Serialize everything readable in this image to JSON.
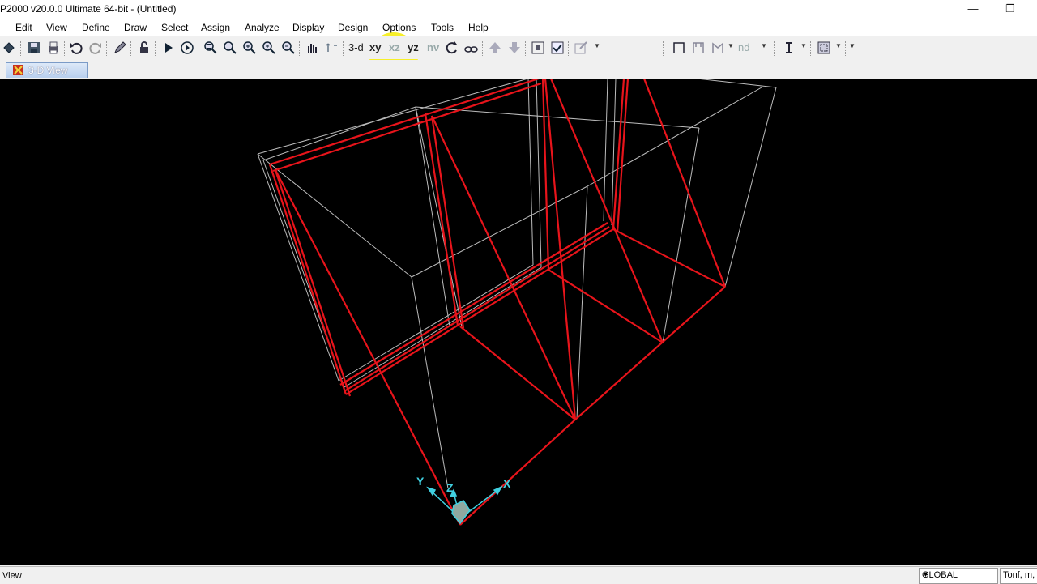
{
  "window": {
    "title": "P2000 v20.0.0 Ultimate 64-bit - (Untitled)",
    "minimize": "—",
    "restore": "❐"
  },
  "menu": [
    "Edit",
    "View",
    "Define",
    "Draw",
    "Select",
    "Assign",
    "Analyze",
    "Display",
    "Design",
    "Options",
    "Tools",
    "Help"
  ],
  "toolbar": {
    "view_3d": "3-d",
    "view_xy": "xy",
    "view_xz": "xz",
    "view_yz": "yz",
    "view_nv": "nv",
    "nd": "nd",
    "icons": [
      "pointer-icon",
      "save-icon",
      "print-icon",
      "undo-icon",
      "redo-icon",
      "pencil-icon",
      "lock-icon",
      "run-icon",
      "run-options-icon",
      "zoom-window-icon",
      "zoom-restore-icon",
      "zoom-in-icon",
      "zoom-in-step-icon",
      "zoom-out-icon",
      "pan-icon",
      "pan-move-icon",
      "rotate-icon",
      "perspective-icon",
      "up-arrow-icon",
      "down-arrow-icon",
      "shrink-icon",
      "check-icon",
      "edit-icon",
      "frame-icon",
      "frame-release-icon",
      "frame-hinge-icon",
      "text-icon",
      "area-icon"
    ]
  },
  "tab": {
    "label": "3-D View"
  },
  "viewport": {
    "background": "#000000",
    "frame_color": "#e8141b",
    "grid_color": "#bcbcbc",
    "axis_color": "#40d0e0",
    "axes": {
      "x": "X",
      "y": "Y",
      "z": "Z"
    }
  },
  "status": {
    "text": "View",
    "coord_system": "GLOBAL",
    "units": "Tonf, m, C"
  }
}
